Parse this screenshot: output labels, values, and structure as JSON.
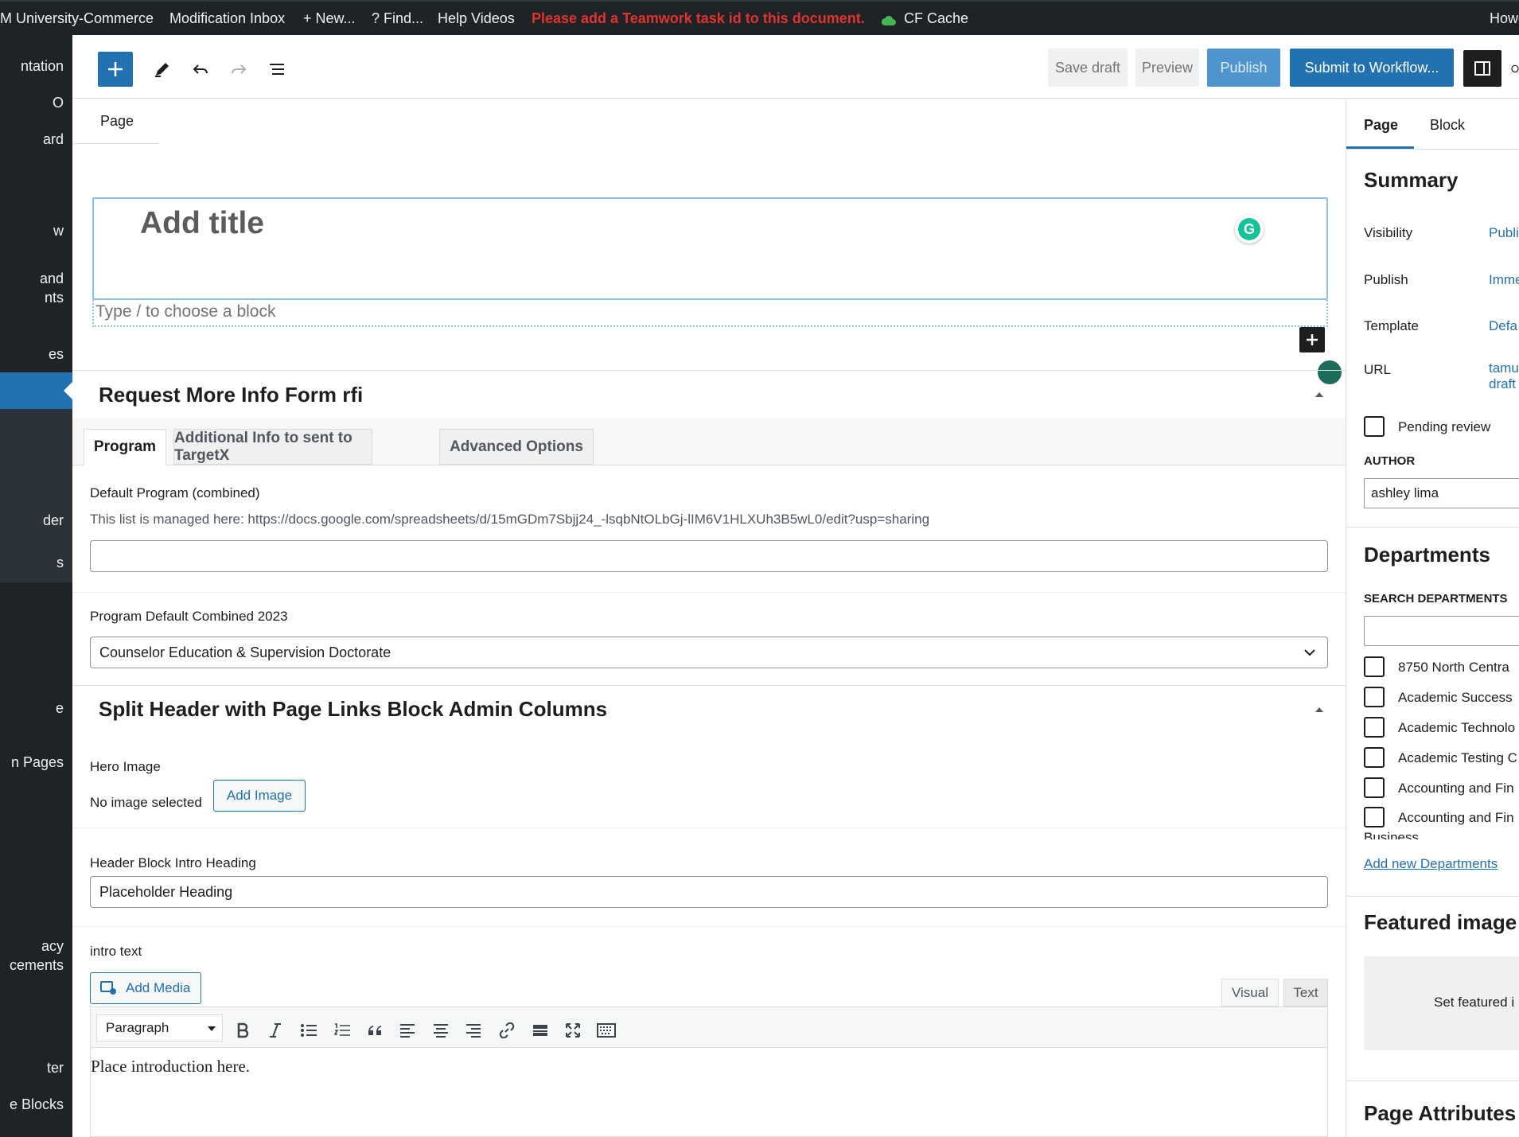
{
  "adminbar": {
    "site": "M University-Commerce",
    "modification_inbox": "Modification Inbox",
    "new": "+ New...",
    "find": "? Find...",
    "help_videos": "Help Videos",
    "warning": "Please add a Teamwork task id to this document.",
    "cf_cache": "CF Cache",
    "howdy": "Howd"
  },
  "sidebar": {
    "items": [
      "ntation",
      "O",
      "ard",
      "w",
      "and",
      "nts",
      "es",
      "der",
      "s",
      "e",
      "n Pages",
      "acy",
      "cements",
      "ter",
      "e Blocks"
    ]
  },
  "toolbar": {
    "save_draft": "Save draft",
    "preview": "Preview",
    "publish": "Publish",
    "submit": "Submit to Workflow..."
  },
  "editor": {
    "breadcrumb": "Page",
    "title_placeholder": "Add title",
    "block_placeholder": "Type / to choose a block"
  },
  "rfi": {
    "title": "Request More Info Form rfi",
    "tabs": [
      "Program",
      "Additional Info to sent to TargetX",
      "Advanced Options"
    ],
    "default_program_label": "Default Program (combined)",
    "default_program_help": "This list is managed here: https://docs.google.com/spreadsheets/d/15mGDm7Sbjj24_-lsqbNtOLbGj-lIM6V1HLXUh3B5wL0/edit?usp=sharing",
    "default_program_value": "",
    "combined_2023_label": "Program Default Combined 2023",
    "combined_2023_value": "Counselor Education & Supervision Doctorate"
  },
  "split_header": {
    "title": "Split Header with Page Links Block Admin Columns",
    "hero_label": "Hero Image",
    "no_image": "No image selected",
    "add_image": "Add Image",
    "intro_heading_label": "Header Block Intro Heading",
    "intro_heading_value": "Placeholder Heading",
    "intro_text_label": "intro text",
    "add_media": "Add Media",
    "visual_tab": "Visual",
    "text_tab": "Text",
    "format_select": "Paragraph",
    "content": "Place introduction here."
  },
  "inspector": {
    "tabs": [
      "Page",
      "Block"
    ],
    "summary_title": "Summary",
    "visibility_label": "Visibility",
    "visibility_value": "Publi",
    "publish_label": "Publish",
    "publish_value": "Imme",
    "template_label": "Template",
    "template_value": "Defa",
    "url_label": "URL",
    "url_value_1": "tamu",
    "url_value_2": "draft",
    "pending_review": "Pending review",
    "author_label": "AUTHOR",
    "author_value": "ashley lima",
    "departments_title": "Departments",
    "search_departments_label": "SEARCH DEPARTMENTS",
    "departments": [
      "8750 North Centra",
      "Academic Success",
      "Academic Technolo",
      "Academic Testing C",
      "Accounting and Fin",
      "Accounting and Fin"
    ],
    "departments_overflow": "Business",
    "add_new_departments": "Add new Departments",
    "featured_image_title": "Featured image",
    "set_featured": "Set featured i",
    "page_attributes_title": "Page Attributes"
  },
  "colors": {
    "accent": "#2271b1",
    "admin_dark": "#1d2327",
    "warning": "#e0332c",
    "grammarly": "#15c39a"
  }
}
